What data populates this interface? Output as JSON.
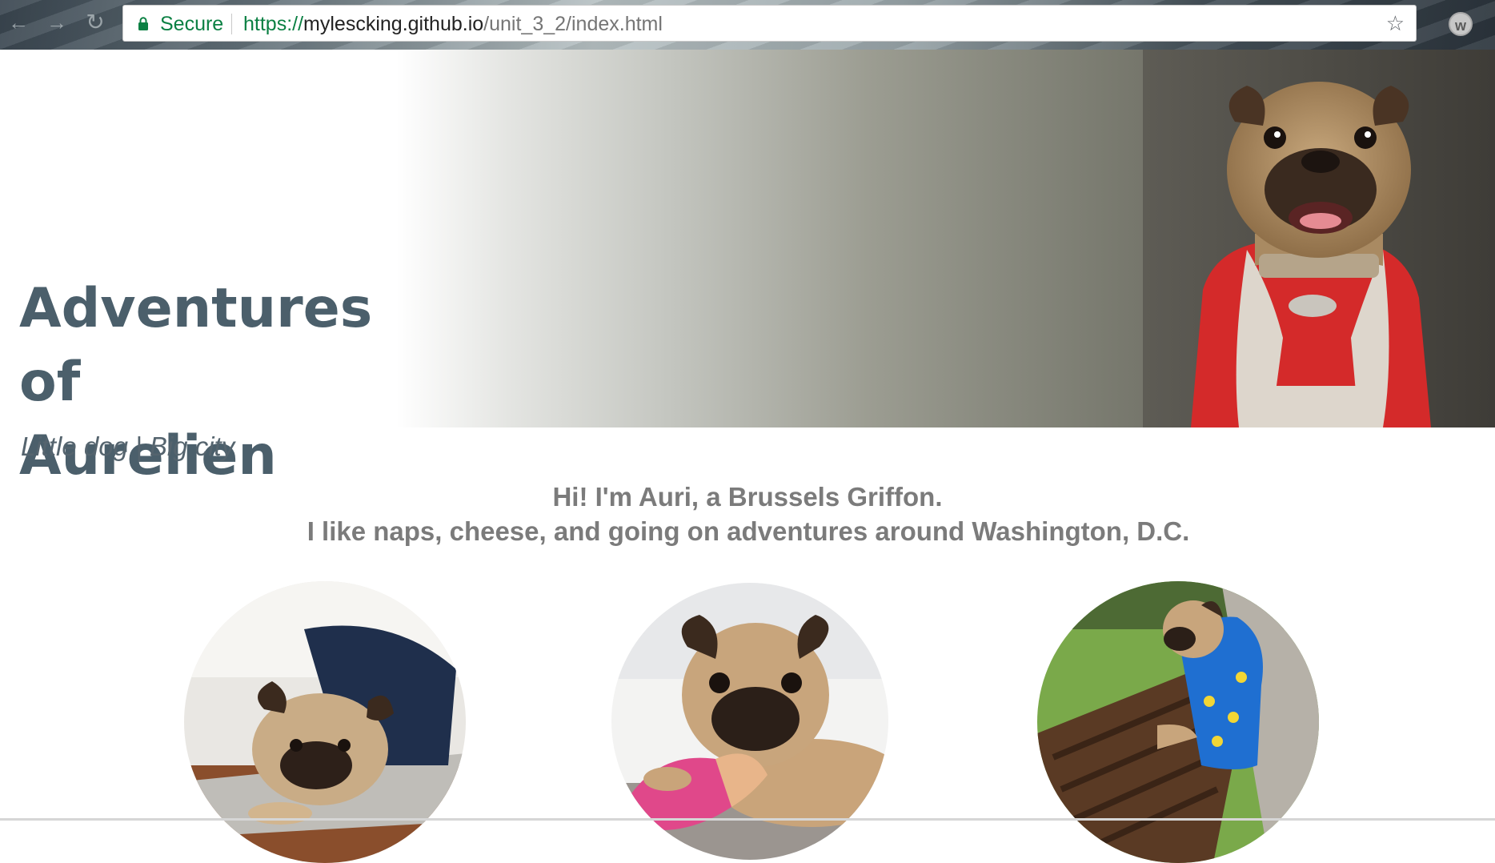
{
  "browser": {
    "security_label": "Secure",
    "url_scheme": "https://",
    "url_host": "mylescking.github.io",
    "url_path": "/unit_3_2/index.html",
    "extension_letter": "w",
    "icons": {
      "back": "arrow-left",
      "forward": "arrow-right",
      "reload": "reload",
      "bookmark": "star",
      "lock": "lock"
    }
  },
  "header": {
    "title_line1": "Adventures of",
    "title_line2": "Aurelien",
    "tagline": "Little dog | Big city"
  },
  "intro": {
    "line1": "Hi! I'm Auri, a Brussels Griffon.",
    "line2": "I like naps, cheese, and going on adventures around Washington, D.C."
  },
  "colors": {
    "title": "#4b5f6b",
    "intro_text": "#7b7b7b",
    "secure_green": "#0b8043",
    "coat_red": "#d42a2a"
  }
}
